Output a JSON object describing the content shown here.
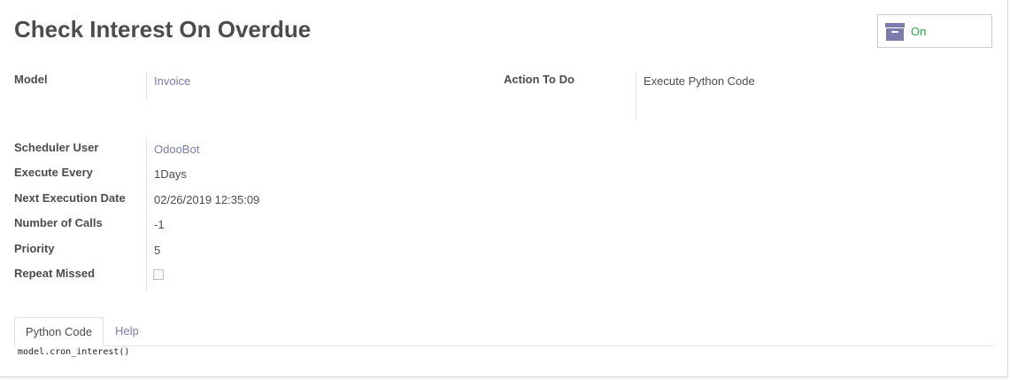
{
  "header": {
    "title": "Check Interest On Overdue",
    "active_toggle": {
      "label": "On",
      "icon": "archive-icon",
      "color": "#28a745",
      "icon_color": "#7c7bad"
    }
  },
  "fields": {
    "model": {
      "label": "Model",
      "value": "Invoice"
    },
    "action_to_do": {
      "label": "Action To Do",
      "value": "Execute Python Code"
    },
    "scheduler_user": {
      "label": "Scheduler User",
      "value": "OdooBot"
    },
    "execute_every": {
      "label": "Execute Every",
      "value": "1Days"
    },
    "next_execution_date": {
      "label": "Next Execution Date",
      "value": "02/26/2019 12:35:09"
    },
    "number_of_calls": {
      "label": "Number of Calls",
      "value": "-1"
    },
    "priority": {
      "label": "Priority",
      "value": "5"
    },
    "repeat_missed": {
      "label": "Repeat Missed",
      "checked": false
    }
  },
  "tabs": [
    {
      "label": "Python Code",
      "active": true
    },
    {
      "label": "Help",
      "active": false
    }
  ],
  "python_code": "model.cron_interest()",
  "colors": {
    "link": "#7c7bad",
    "text": "#4c4c4c",
    "on": "#28a745"
  }
}
